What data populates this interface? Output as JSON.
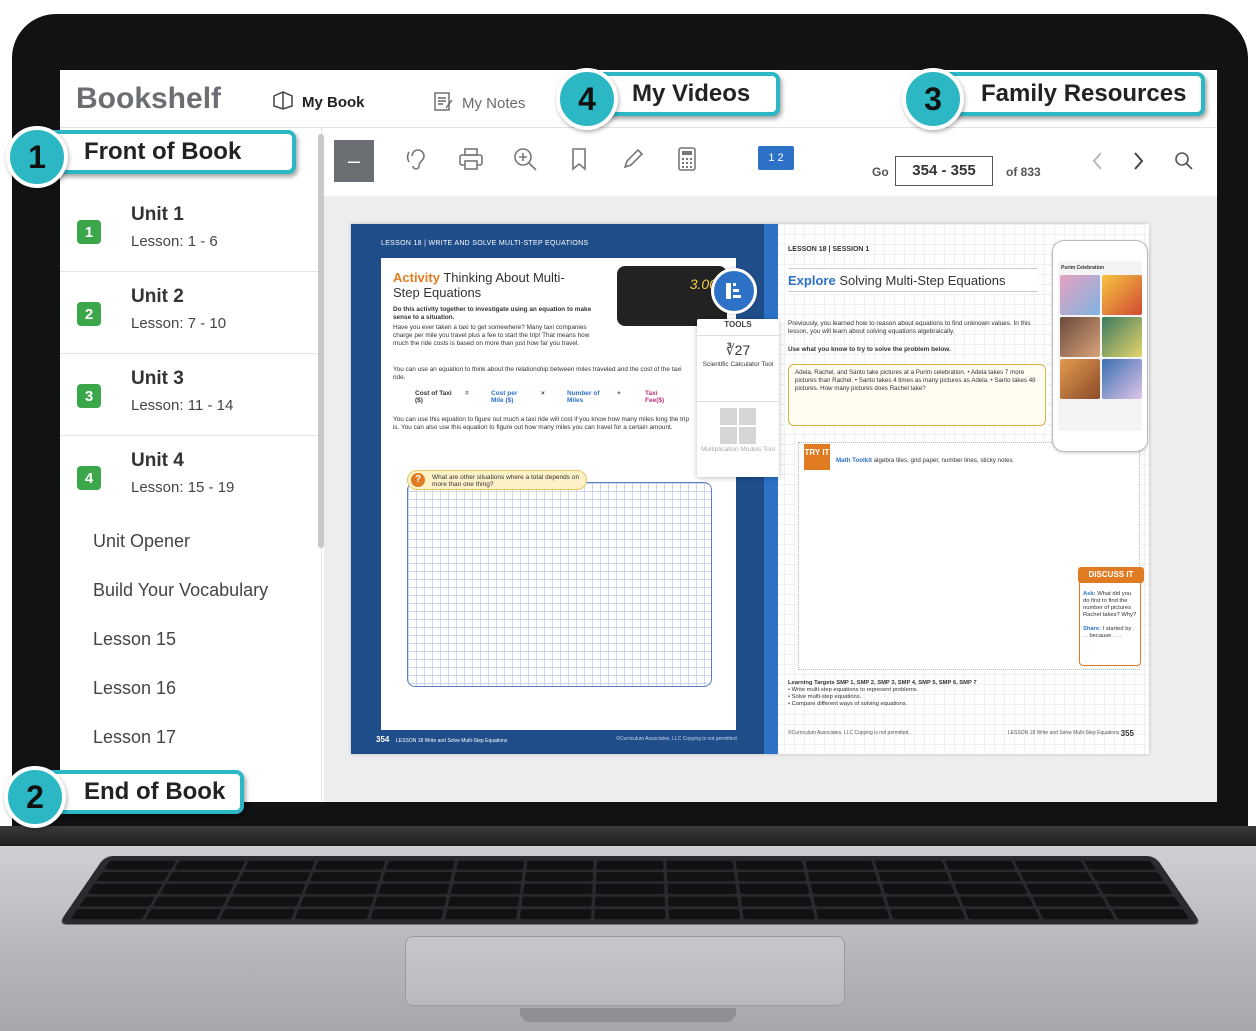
{
  "app": {
    "title": "Bookshelf"
  },
  "nav": {
    "my_book": "My Book",
    "my_notes": "My Notes",
    "my_videos": "My Videos",
    "family_resources": "Family Resources"
  },
  "toolbar": {
    "minus": "–",
    "pages_badge": "1 2",
    "go_label": "Go",
    "page_value": "354 - 355",
    "of_total": "of 833"
  },
  "sidebar": {
    "front_of_book": "Front of Book",
    "end_of_book": "End of Book",
    "units": [
      {
        "badge": "1",
        "name": "Unit 1",
        "lessons": "Lesson: 1 - 6"
      },
      {
        "badge": "2",
        "name": "Unit 2",
        "lessons": "Lesson: 7 - 10"
      },
      {
        "badge": "3",
        "name": "Unit 3",
        "lessons": "Lesson: 11 - 14"
      },
      {
        "badge": "4",
        "name": "Unit 4",
        "lessons": "Lesson: 15 - 19"
      }
    ],
    "sub_items": [
      "Unit Opener",
      "Build Your Vocabulary",
      "Lesson 15",
      "Lesson 16",
      "Lesson 17"
    ]
  },
  "callouts": {
    "c1": "1",
    "c2": "2",
    "c3": "3",
    "c4": "4"
  },
  "left_page": {
    "header": "LESSON 18 | WRITE AND SOLVE MULTI-STEP EQUATIONS",
    "activity_word": "Activity",
    "activity_title": "Thinking About Multi-Step Equations",
    "intro": "Do this activity together to investigate using an equation to make sense to a situation.",
    "p1": "Have you ever taken a taxi to get somewhere? Many taxi companies charge per mile you travel plus a fee to start the trip! That means how much the ride costs is based on more than just how far you travel.",
    "p2": "You can use an equation to think about the relationship between miles traveled and the cost of the taxi ride.",
    "eq_cost": "Cost of Taxi ($)",
    "eq_eq": "=",
    "eq_cpm": "Cost per Mile ($)",
    "eq_times": "×",
    "eq_miles": "Number of Miles",
    "eq_plus": "+",
    "eq_fee": "Taxi Fee($)",
    "p3": "You can use this equation to figure out much a taxi ride will cost if you know how many miles long the trip is. You can also use this equation to figure out how many miles you can travel for a certain amount.",
    "question": "What are other situations where a total depends on more than one thing?",
    "meter": "3.00",
    "meter_extras": "EXTRAS",
    "meter_total": "TOTAL FARE",
    "page_num": "354",
    "foot_lesson": "LESSON 18 Write and Solve Multi-Step Equations",
    "foot_copy": "©Curriculum Associates, LLC Copying is not permitted."
  },
  "tools": {
    "label": "TOOLS",
    "sci_frac": "∛27",
    "sci_label": "Scientific Calculator Tool",
    "mult_label": "Multiplication Models Tool"
  },
  "right_page": {
    "header": "LESSON 18 | SESSION 1",
    "explore_word": "Explore",
    "explore_title": "Solving Multi-Step Equations",
    "p1": "Previously, you learned how to reason about equations to find unknown values. In this lesson, you will learn about solving equations algebraically.",
    "p2": "Use what you know to try to solve the problem below.",
    "problem": "Adela, Rachel, and Santo take pictures at a Purim celebration. • Adela takes 7 more pictures than Rachel. • Santo takes 4 times as many pictures as Adela. • Santo takes 48 pictures. How many pictures does Rachel take?",
    "try_it": "TRY IT",
    "toolkit_word": "Math Toolkit",
    "toolkit": "algebra tiles, grid paper, number lines, sticky notes",
    "discuss_tag": "DISCUSS IT",
    "discuss_ask": "Ask:",
    "discuss_ask_text": "What did you do first to find the number of pictures Rachel takes? Why?",
    "discuss_share": "Share:",
    "discuss_share_text": "I started by . . . because . . .",
    "phone_title": "Purim Celebration",
    "learning_targets": "Learning Targets SMP 1, SMP 2, SMP 3, SMP 4, SMP 5, SMP 6, SMP 7",
    "lt1": "• Write multi-step equations to represent problems.",
    "lt2": "• Solve multi-step equations.",
    "lt3": "• Compare different ways of solving equations.",
    "foot_copy": "©Curriculum Associates, LLC Copying is not permitted.",
    "foot_lesson": "LESSON 18 Write and Solve Multi-Step Equations",
    "page_num": "355"
  },
  "colors": {
    "accent_teal": "#2bb7c4",
    "unit_green": "#3ca64b",
    "book_blue": "#1f4d8a",
    "orange": "#e07b22"
  }
}
